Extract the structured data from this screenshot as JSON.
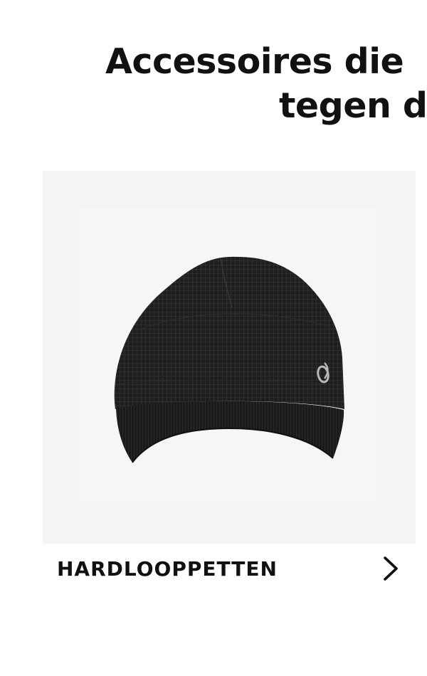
{
  "section": {
    "heading_line1": "Accessoires die",
    "heading_line2": "tegen d"
  },
  "card": {
    "label": "HARDLOOPPETTEN",
    "image": "black-running-cap",
    "icons": {
      "arrow": "chevron-right-icon",
      "brand": "asics-logo-icon"
    }
  },
  "colors": {
    "text": "#111111",
    "card_background": "#f4f4f4",
    "cap": "#1c1c1c",
    "logo": "#b8b8b8"
  }
}
